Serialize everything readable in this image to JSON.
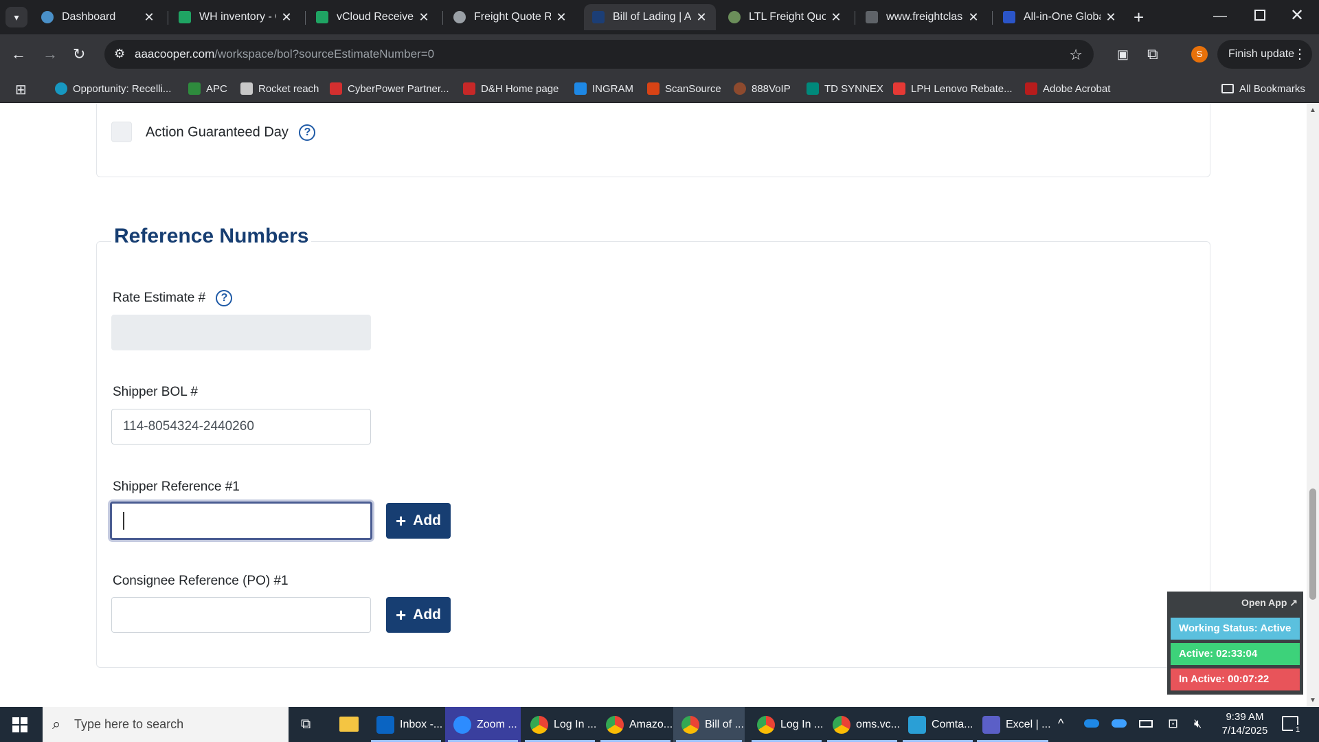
{
  "browser": {
    "tabs": [
      {
        "title": "Dashboard",
        "icon": "dashboard-favicon"
      },
      {
        "title": "WH inventory - G",
        "icon": "sheets-favicon"
      },
      {
        "title": "vCloud Receive F",
        "icon": "sheets-favicon"
      },
      {
        "title": "Freight Quote Re",
        "icon": "freight-favicon"
      },
      {
        "title": "Bill of Lading | A",
        "icon": "aaa-favicon",
        "active": true
      },
      {
        "title": "LTL Freight Quot",
        "icon": "ltl-favicon"
      },
      {
        "title": "www.freightclass",
        "icon": "fcc-favicon"
      },
      {
        "title": "All-in-One Globa",
        "icon": "17-favicon"
      }
    ],
    "url_host": "aaacooper.com",
    "url_path": "/workspace/bol?sourceEstimateNumber=0",
    "profile_initial": "S",
    "finish_update_label": "Finish update",
    "bookmarks": [
      "Opportunity: Recelli...",
      "APC",
      "Rocket reach",
      "CyberPower Partner...",
      "D&H Home page",
      "INGRAM",
      "ScanSource",
      "888VoIP",
      "TD SYNNEX",
      "LPH Lenovo Rebate...",
      "Adobe Acrobat"
    ],
    "all_bookmarks_label": "All Bookmarks"
  },
  "page": {
    "action_guaranteed_label": "Action Guaranteed Day",
    "section_title": "Reference Numbers",
    "rate_estimate_label": "Rate Estimate #",
    "rate_estimate_value": "",
    "shipper_bol_label": "Shipper BOL #",
    "shipper_bol_value": "114-8054324-2440260",
    "shipper_ref_label": "Shipper Reference #1",
    "shipper_ref_value": "",
    "consignee_ref_label": "Consignee Reference (PO) #1",
    "consignee_ref_value": "",
    "add_label": "Add"
  },
  "widget": {
    "open_app": "Open App ↗",
    "working_status": "Working Status: Active",
    "active": "Active: 02:33:04",
    "inactive": "In Active: 00:07:22"
  },
  "taskbar": {
    "search_placeholder": "Type here to search",
    "apps": [
      "Inbox -...",
      "Zoom ...",
      "Log In ...",
      "Amazo...",
      "Bill of ...",
      "Log In ...",
      "oms.vc...",
      "Comta...",
      "Excel | ..."
    ],
    "time": "9:39 AM",
    "date": "7/14/2025",
    "notification_count": "1"
  }
}
